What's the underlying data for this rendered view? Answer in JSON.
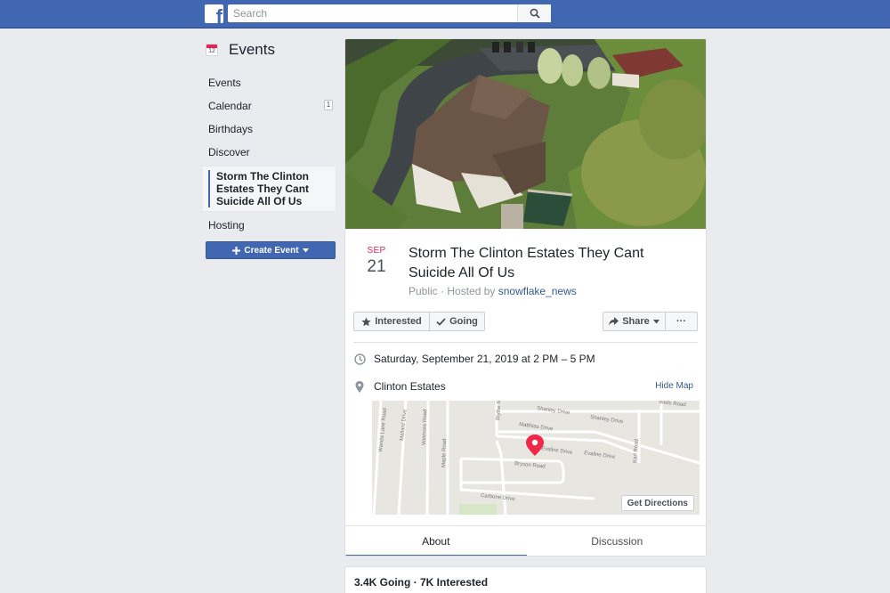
{
  "topbar": {
    "logo": "f",
    "search_placeholder": "Search"
  },
  "nav": {
    "icon_date": "12",
    "title": "Events",
    "items": [
      {
        "label": "Events"
      },
      {
        "label": "Calendar",
        "badge": "1"
      },
      {
        "label": "Birthdays"
      },
      {
        "label": "Discover"
      },
      {
        "label": "Storm The Clinton Estates They Cant Suicide All Of Us"
      },
      {
        "label": "Hosting"
      }
    ],
    "create_label": "Create Event"
  },
  "event": {
    "month": "SEP",
    "day": "21",
    "title": "Storm The Clinton Estates They Cant Suicide All Of Us",
    "privacy_host": "Public · Hosted by ",
    "host": "snowflake_news",
    "interested_label": "Interested",
    "going_label": "Going",
    "share_label": "Share",
    "more_label": "···",
    "datetime": "Saturday, September 21, 2019 at 2 PM – 5 PM",
    "location": "Clinton Estates",
    "hide_map": "Hide Map",
    "get_directions": "Get Directions",
    "map_streets": [
      "Shanley Drive",
      "Shanley Drive",
      "Matthias Drive",
      "Evaline Drive",
      "Evaline Drive",
      "Bryson Road",
      "Carbone Drive",
      "Maple Road",
      "Wetmore Road",
      "Mallard Drive",
      "Wanda Lane Road",
      "Blythe Road",
      "Karl Road",
      "Wells Road"
    ],
    "tabs": [
      "About",
      "Discussion"
    ]
  },
  "stats": "3.4K Going · 7K Interested",
  "colors": {
    "brand": "#4267b2",
    "accent_red": "#e0245e",
    "link": "#365899",
    "pin": "#f02849"
  }
}
